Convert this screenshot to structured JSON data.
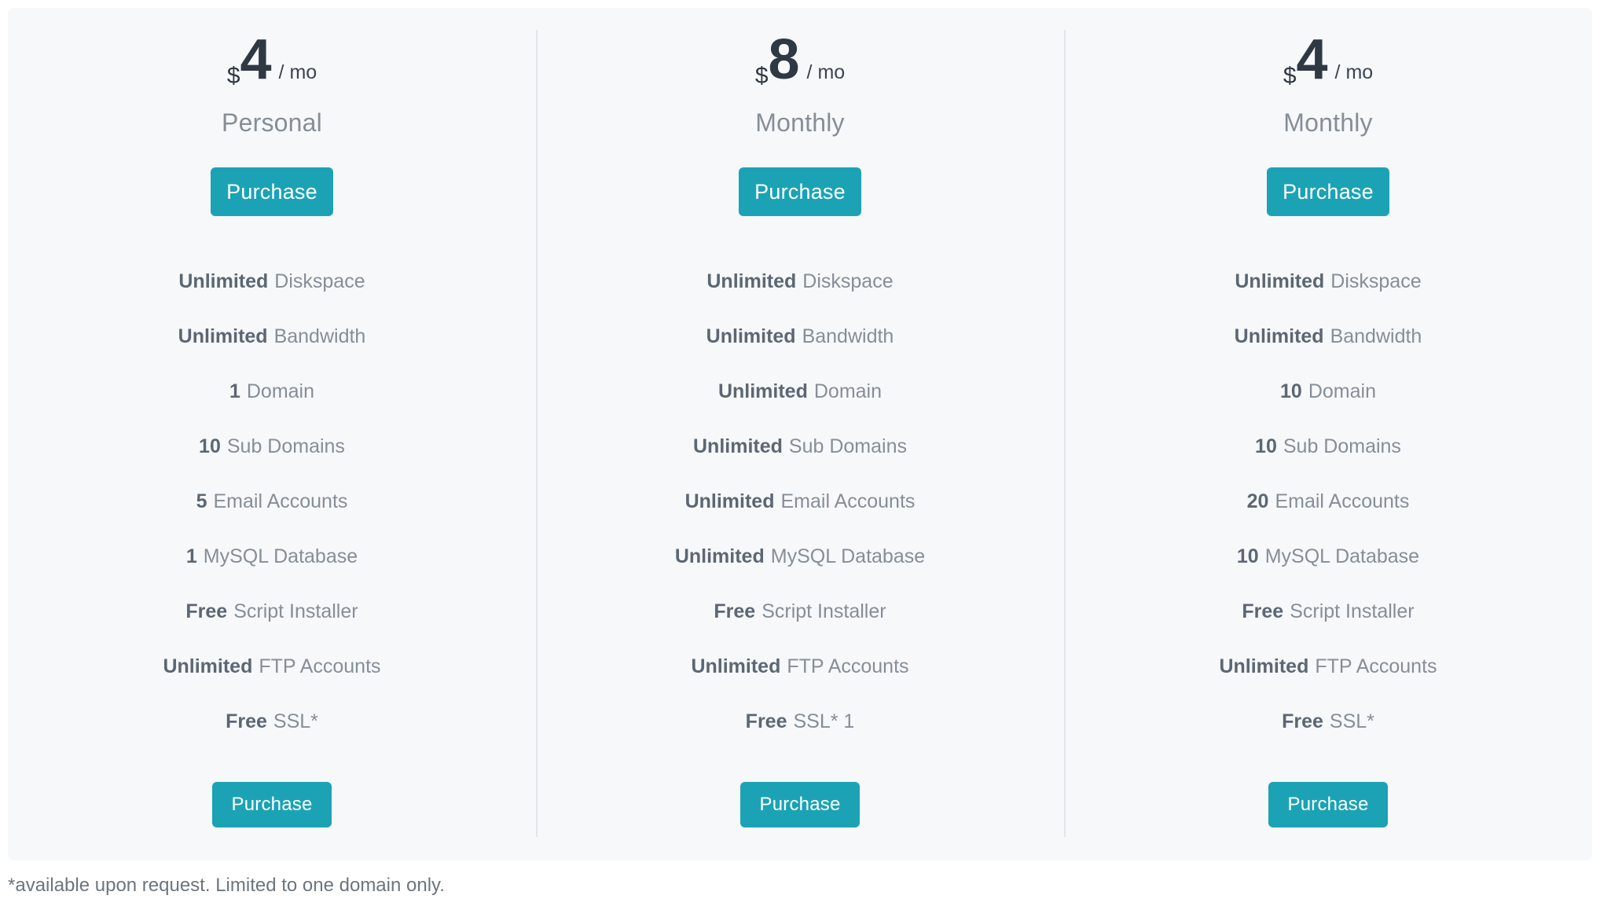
{
  "card": {
    "background": "#f7f8fa",
    "divider_color": "#e2e6ea"
  },
  "theme": {
    "accent": "#1ba3b5",
    "title_color": "#868e96",
    "price_color": "#2f3943",
    "feature_value_color": "#5c6773",
    "feature_label_color": "#868e96"
  },
  "plans": [
    {
      "currency": "$",
      "amount": "4",
      "period": "/ mo",
      "title": "Personal",
      "top_button_label": "Purchase",
      "bottom_button_label": "Purchase",
      "features": [
        {
          "value": "Unlimited",
          "label": "Diskspace"
        },
        {
          "value": "Unlimited",
          "label": "Bandwidth"
        },
        {
          "value": "1",
          "label": "Domain"
        },
        {
          "value": "10",
          "label": "Sub Domains"
        },
        {
          "value": "5",
          "label": "Email Accounts"
        },
        {
          "value": "1",
          "label": "MySQL Database"
        },
        {
          "value": "Free",
          "label": "Script Installer"
        },
        {
          "value": "Unlimited",
          "label": "FTP Accounts"
        },
        {
          "value": "Free",
          "label": "SSL*"
        }
      ]
    },
    {
      "currency": "$",
      "amount": "8",
      "period": "/ mo",
      "title": "Monthly",
      "top_button_label": "Purchase",
      "bottom_button_label": "Purchase",
      "features": [
        {
          "value": "Unlimited",
          "label": "Diskspace"
        },
        {
          "value": "Unlimited",
          "label": "Bandwidth"
        },
        {
          "value": "Unlimited",
          "label": "Domain"
        },
        {
          "value": "Unlimited",
          "label": "Sub Domains"
        },
        {
          "value": "Unlimited",
          "label": "Email Accounts"
        },
        {
          "value": "Unlimited",
          "label": "MySQL Database"
        },
        {
          "value": "Free",
          "label": "Script Installer"
        },
        {
          "value": "Unlimited",
          "label": "FTP Accounts"
        },
        {
          "value": "Free",
          "label": "SSL* 1"
        }
      ]
    },
    {
      "currency": "$",
      "amount": "4",
      "period": "/ mo",
      "title": "Monthly",
      "top_button_label": "Purchase",
      "bottom_button_label": "Purchase",
      "features": [
        {
          "value": "Unlimited",
          "label": "Diskspace"
        },
        {
          "value": "Unlimited",
          "label": "Bandwidth"
        },
        {
          "value": "10",
          "label": "Domain"
        },
        {
          "value": "10",
          "label": "Sub Domains"
        },
        {
          "value": "20",
          "label": "Email Accounts"
        },
        {
          "value": "10",
          "label": "MySQL Database"
        },
        {
          "value": "Free",
          "label": "Script Installer"
        },
        {
          "value": "Unlimited",
          "label": "FTP Accounts"
        },
        {
          "value": "Free",
          "label": "SSL*"
        }
      ]
    }
  ],
  "footnote": "*available upon request. Limited to one domain only."
}
